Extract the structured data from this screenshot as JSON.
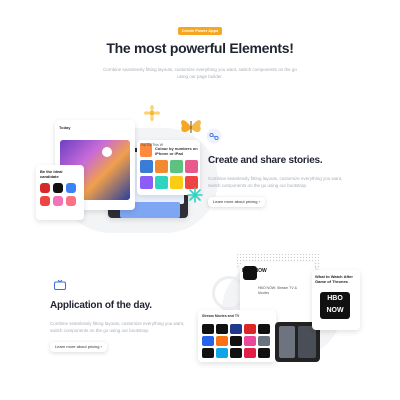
{
  "hero": {
    "badge": "Create Power Apps",
    "title": "The most powerful Elements!",
    "subtitle": "Combine seamlessly fitting layouts, customize everything you want, switch components on the go using our page builder."
  },
  "section1": {
    "title": "Create and share stories.",
    "subtitle": "Combine seamlessly fitting layouts, customize everything you want, switch components on the go using our bootstrap.",
    "button": "Learn more about pricing ›",
    "mock": {
      "today_label": "Today",
      "top_label": "Top Ga This W",
      "colour_card_text": "Colour by numbers on iPhone or iPad",
      "ideal_card_text": "Be the ideal candidate"
    }
  },
  "section2": {
    "title": "Application of the day.",
    "subtitle": "Combine seamlessly fitting layouts, customize everything you want, switch components on the go using our bootstrap.",
    "button": "Learn more about pricing ›",
    "mock": {
      "hbo_logo": "HBO NOW",
      "hbo_small": "HBO NOW: Stream TV & Movies",
      "stream_text": "Stream Movies and TV",
      "watch_text": "What to Watch After Game of Thrones",
      "hbo_now_box": "HBO NOW"
    }
  },
  "colors": {
    "badge": "#f6a623",
    "title": "#1f2430",
    "muted": "#a7adb8"
  }
}
